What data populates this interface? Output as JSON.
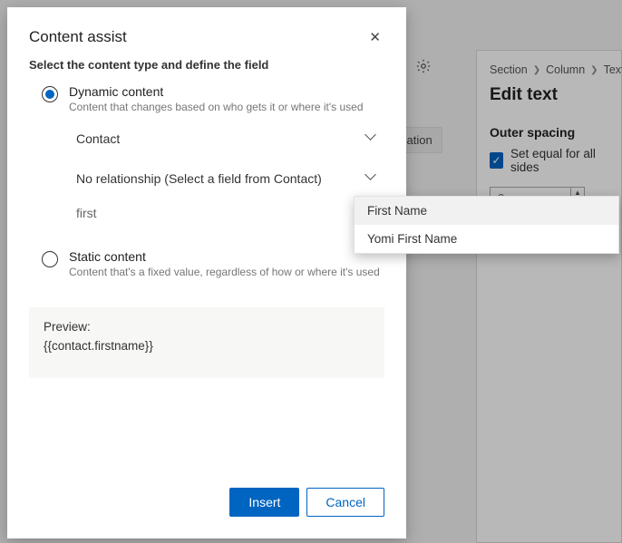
{
  "dialog": {
    "title": "Content assist",
    "subtitle": "Select the content type and define the field",
    "options": {
      "dynamic": {
        "label": "Dynamic content",
        "desc": "Content that changes based on who gets it or where it's used"
      },
      "static": {
        "label": "Static content",
        "desc": "Content that's a fixed value, regardless of how or where it's used"
      }
    },
    "select_entity": "Contact",
    "select_relationship": "No relationship (Select a field from Contact)",
    "field_input": "first",
    "preview": {
      "label": "Preview:",
      "value": "{{contact.firstname}}"
    },
    "buttons": {
      "insert": "Insert",
      "cancel": "Cancel"
    }
  },
  "flyout": {
    "items": [
      "First Name",
      "Yomi First Name"
    ]
  },
  "side_panel": {
    "breadcrumb": [
      "Section",
      "Column",
      "Text"
    ],
    "title": "Edit text",
    "outer_spacing_label": "Outer spacing",
    "checkbox_label": "Set equal for all sides",
    "spacing_value": "0px"
  },
  "bg": {
    "tab_chip": "zation"
  }
}
